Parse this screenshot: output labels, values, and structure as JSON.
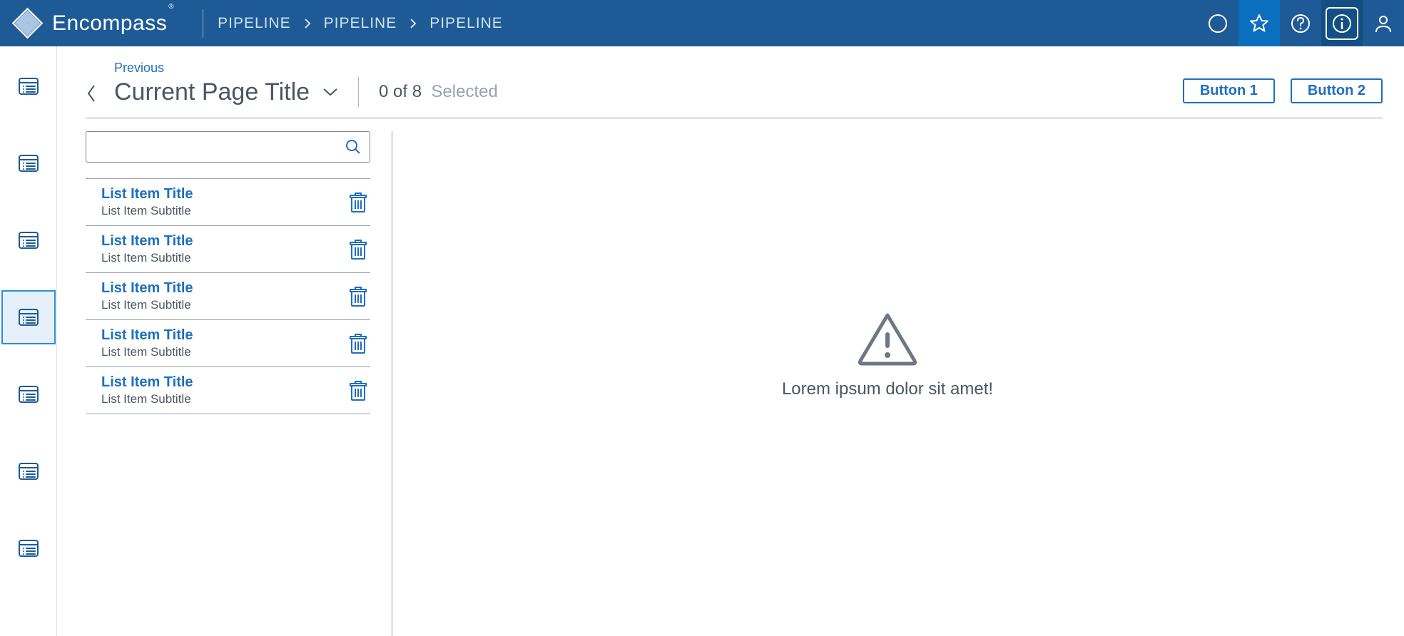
{
  "brand": {
    "name": "Encompass",
    "registered": "®"
  },
  "breadcrumbs": [
    "PIPELINE",
    "PIPELINE",
    "PIPELINE"
  ],
  "header_icons": [
    "circle",
    "star",
    "help",
    "info",
    "user"
  ],
  "rail": {
    "count": 7,
    "active_index": 3
  },
  "page": {
    "previous_label": "Previous",
    "title": "Current Page Title",
    "selection_count": "0 of 8",
    "selection_label": "Selected"
  },
  "buttons": {
    "b1": "Button 1",
    "b2": "Button 2"
  },
  "search": {
    "placeholder": ""
  },
  "list": [
    {
      "title": "List Item Title",
      "subtitle": "List Item Subtitle"
    },
    {
      "title": "List Item Title",
      "subtitle": "List Item Subtitle"
    },
    {
      "title": "List Item Title",
      "subtitle": "List Item Subtitle"
    },
    {
      "title": "List Item Title",
      "subtitle": "List Item Subtitle"
    },
    {
      "title": "List Item Title",
      "subtitle": "List Item Subtitle"
    }
  ],
  "content": {
    "message": "Lorem ipsum dolor sit amet!"
  }
}
